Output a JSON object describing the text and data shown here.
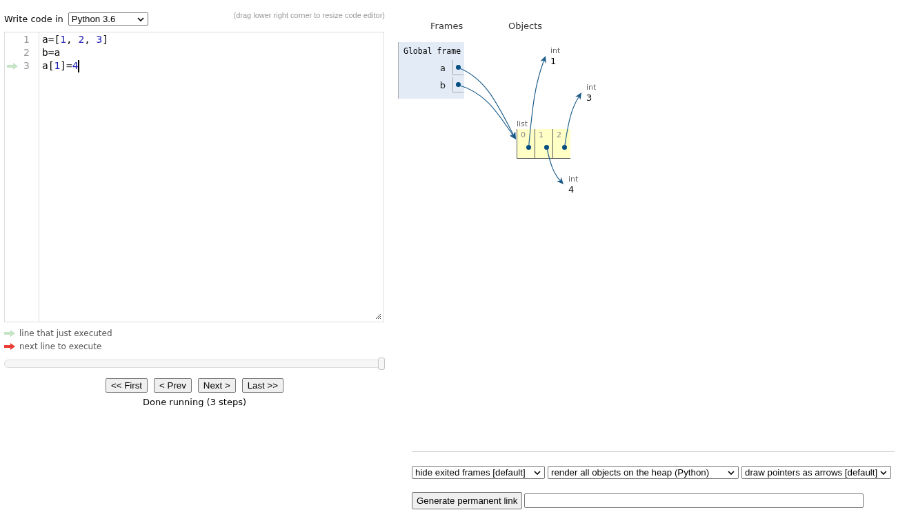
{
  "editor": {
    "label": "Write code in",
    "language": "Python 3.6",
    "hint": "(drag lower right corner to resize code editor)",
    "lines": [
      {
        "number": "1",
        "executed": false,
        "cursor": false,
        "tokens": [
          {
            "kind": "variable",
            "text": "a"
          },
          {
            "kind": "operator",
            "text": "="
          },
          {
            "kind": "bracket",
            "text": "["
          },
          {
            "kind": "number",
            "text": "1"
          },
          {
            "kind": "punctuation",
            "text": ", "
          },
          {
            "kind": "number",
            "text": "2"
          },
          {
            "kind": "punctuation",
            "text": ", "
          },
          {
            "kind": "number",
            "text": "3"
          },
          {
            "kind": "bracket",
            "text": "]"
          }
        ]
      },
      {
        "number": "2",
        "executed": false,
        "cursor": false,
        "tokens": [
          {
            "kind": "variable",
            "text": "b"
          },
          {
            "kind": "operator",
            "text": "="
          },
          {
            "kind": "variable",
            "text": "a"
          }
        ]
      },
      {
        "number": "3",
        "executed": true,
        "cursor": true,
        "tokens": [
          {
            "kind": "variable",
            "text": "a"
          },
          {
            "kind": "bracket",
            "text": "["
          },
          {
            "kind": "number",
            "text": "1"
          },
          {
            "kind": "bracket",
            "text": "]"
          },
          {
            "kind": "operator",
            "text": "="
          },
          {
            "kind": "number",
            "text": "4"
          }
        ]
      }
    ]
  },
  "legend": [
    {
      "label": "line that just executed",
      "color": "#c5e3c5"
    },
    {
      "label": "next line to execute",
      "color": "#e93f34"
    }
  ],
  "navigation": {
    "slider": {
      "level": 1
    },
    "buttons": [
      "<< First",
      "< Prev",
      "Next >",
      "Last >>"
    ],
    "status": "Done running (3 steps)"
  },
  "visualization": {
    "frames_heading": "Frames",
    "objects_heading": "Objects",
    "frames": [
      {
        "title": "Global frame",
        "variables": [
          {
            "name": "a",
            "kind": "pointer"
          },
          {
            "name": "b",
            "kind": "pointer"
          }
        ]
      }
    ],
    "objects": [
      {
        "kind": "list",
        "type_label": "list",
        "items": [
          {
            "index": "0",
            "value": {
              "kind": "int",
              "type_label": "int",
              "value": "1"
            }
          },
          {
            "index": "1",
            "value": {
              "kind": "int",
              "type_label": "int",
              "value": "4"
            }
          },
          {
            "index": "2",
            "value": {
              "kind": "int",
              "type_label": "int",
              "value": "3"
            }
          }
        ]
      }
    ]
  },
  "options": {
    "selects": [
      "hide exited frames [default]",
      "render all objects on the heap (Python)",
      "draw pointers as arrows [default]"
    ],
    "permalink_button": "Generate permanent link"
  }
}
